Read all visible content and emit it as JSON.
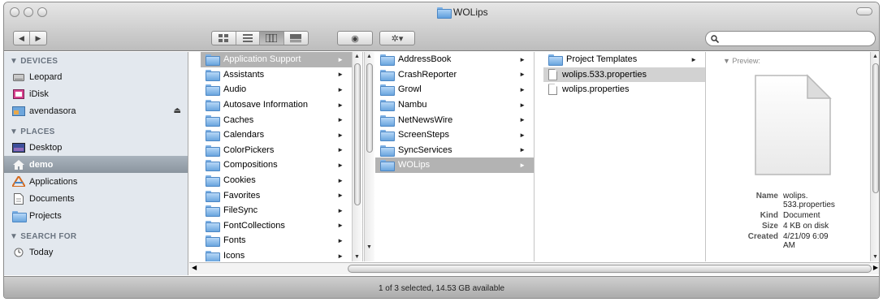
{
  "window": {
    "title": "WOLips"
  },
  "toolbar": {
    "back_label": "◀",
    "forward_label": "▶",
    "quicklook_label": "◉",
    "action_label": "✲▾",
    "search": {
      "value": "",
      "placeholder": ""
    }
  },
  "sidebar": {
    "devices_heading": "▼ DEVICES",
    "devices": [
      {
        "label": "Leopard"
      },
      {
        "label": "iDisk"
      },
      {
        "label": "avendasora"
      }
    ],
    "places_heading": "▼ PLACES",
    "places": [
      {
        "label": "Desktop"
      },
      {
        "label": "demo"
      },
      {
        "label": "Applications"
      },
      {
        "label": "Documents"
      },
      {
        "label": "Projects"
      }
    ],
    "search_heading": "▼ SEARCH FOR",
    "search_items": [
      {
        "label": "Today"
      }
    ]
  },
  "column1": {
    "items": [
      {
        "label": "Application Support"
      },
      {
        "label": "Assistants"
      },
      {
        "label": "Audio"
      },
      {
        "label": "Autosave Information"
      },
      {
        "label": "Caches"
      },
      {
        "label": "Calendars"
      },
      {
        "label": "ColorPickers"
      },
      {
        "label": "Compositions"
      },
      {
        "label": "Cookies"
      },
      {
        "label": "Favorites"
      },
      {
        "label": "FileSync"
      },
      {
        "label": "FontCollections"
      },
      {
        "label": "Fonts"
      },
      {
        "label": "Icons"
      }
    ]
  },
  "column2": {
    "items": [
      {
        "label": "AddressBook"
      },
      {
        "label": "CrashReporter"
      },
      {
        "label": "Growl"
      },
      {
        "label": "Nambu"
      },
      {
        "label": "NetNewsWire"
      },
      {
        "label": "ScreenSteps"
      },
      {
        "label": "SyncServices"
      },
      {
        "label": "WOLips"
      }
    ]
  },
  "column3": {
    "items": [
      {
        "label": "Project Templates"
      },
      {
        "label": "wolips.533.properties"
      },
      {
        "label": "wolips.properties"
      }
    ]
  },
  "preview": {
    "heading": "▼ Preview:",
    "name_key": "Name",
    "name_value": "wolips.\n533.properties",
    "kind_key": "Kind",
    "kind_value": "Document",
    "size_key": "Size",
    "size_value": "4 KB on disk",
    "created_key": "Created",
    "created_value": "4/21/09 6:09\nAM"
  },
  "status": {
    "text": "1 of 3 selected, 14.53 GB available"
  }
}
